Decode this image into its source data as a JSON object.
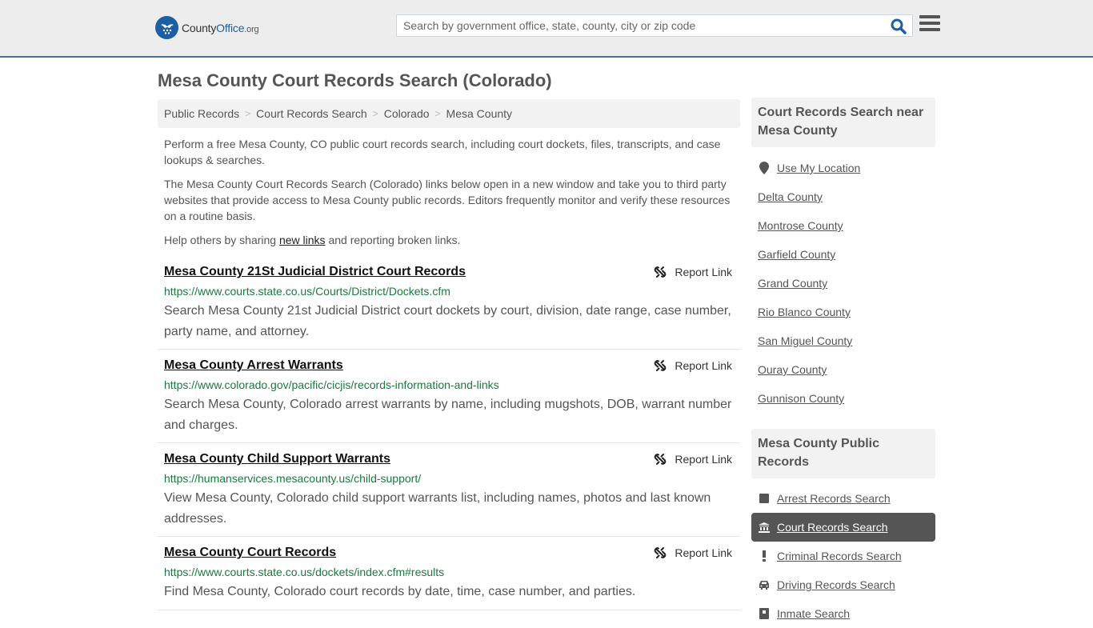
{
  "header": {
    "logo": {
      "part1": "County",
      "part2": "Office",
      "part3": ".org"
    },
    "search": {
      "placeholder": "Search by government office, state, county, city or zip code",
      "value": ""
    },
    "icons": {
      "search": "search-icon",
      "menu": "hamburger-menu-icon"
    }
  },
  "page": {
    "title": "Mesa County Court Records Search (Colorado)"
  },
  "breadcrumb": [
    {
      "label": "Public Records"
    },
    {
      "label": "Court Records Search"
    },
    {
      "label": "Colorado"
    },
    {
      "label": "Mesa County"
    }
  ],
  "intro": {
    "p1": "Perform a free Mesa County, CO public court records search, including court dockets, files, transcripts, and case lookups & searches.",
    "p2": "The Mesa County Court Records Search (Colorado) links below open in a new window and take you to third party websites that provide access to Mesa County public records. Editors frequently monitor and verify these resources on a routine basis.",
    "p3_before": "Help others by sharing ",
    "p3_link": "new links",
    "p3_after": " and reporting broken links."
  },
  "results": [
    {
      "title": "Mesa County 21St Judicial District Court Records",
      "url": "https://www.courts.state.co.us/Courts/District/Dockets.cfm",
      "description": "Search Mesa County 21st Judicial District court dockets by court, division, date range, case number, party name, and attorney.",
      "report_label": "Report Link"
    },
    {
      "title": "Mesa County Arrest Warrants",
      "url": "https://www.colorado.gov/pacific/cicjis/records-information-and-links",
      "description": "Search Mesa County, Colorado arrest warrants by name, including mugshots, DOB, warrant number and charges.",
      "report_label": "Report Link"
    },
    {
      "title": "Mesa County Child Support Warrants",
      "url": "https://humanservices.mesacounty.us/child-support/",
      "description": "View Mesa County, Colorado child support warrants list, including names, photos and last known addresses.",
      "report_label": "Report Link"
    },
    {
      "title": "Mesa County Court Records",
      "url": "https://www.courts.state.co.us/dockets/index.cfm#results",
      "description": "Find Mesa County, Colorado court records by date, time, case number, and parties.",
      "report_label": "Report Link"
    }
  ],
  "sidebar": {
    "nearby": {
      "heading": "Court Records Search near Mesa County",
      "use_location": "Use My Location",
      "counties": [
        "Delta County",
        "Montrose County",
        "Garfield County",
        "Grand County",
        "Rio Blanco County",
        "San Miguel County",
        "Ouray County",
        "Gunnison County"
      ]
    },
    "public_records": {
      "heading": "Mesa County Public Records",
      "items": [
        {
          "label": "Arrest Records Search",
          "icon": "square-icon",
          "active": false
        },
        {
          "label": "Court Records Search",
          "icon": "courthouse-icon",
          "active": true
        },
        {
          "label": "Criminal Records Search",
          "icon": "exclamation-icon",
          "active": false
        },
        {
          "label": "Driving Records Search",
          "icon": "car-icon",
          "active": false
        },
        {
          "label": "Inmate Search",
          "icon": "inmate-icon",
          "active": false
        }
      ]
    }
  },
  "colors": {
    "brand_blue": "#1d5fa0",
    "header_border": "#3a76a8",
    "url_green": "#1a7a3c",
    "active_item_bg": "#555555"
  }
}
